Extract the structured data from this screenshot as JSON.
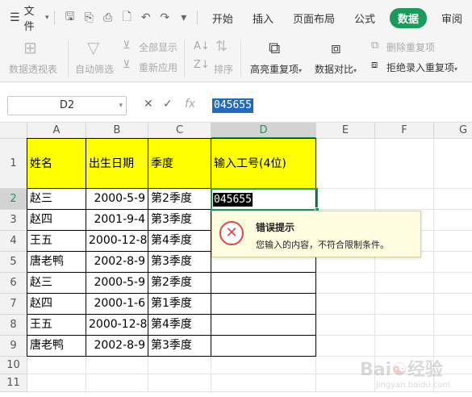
{
  "menu": {
    "file_label": "文件",
    "tabs": [
      {
        "label": "开始",
        "active": false
      },
      {
        "label": "插入",
        "active": false
      },
      {
        "label": "页面布局",
        "active": false
      },
      {
        "label": "公式",
        "active": false
      },
      {
        "label": "数据",
        "active": true
      },
      {
        "label": "审阅",
        "active": false
      }
    ]
  },
  "ribbon": {
    "pivot_label": "数据透视表",
    "autofilter_label": "自动筛选",
    "show_all_label": "全部显示",
    "reapply_label": "重新应用",
    "sort_label": "排序",
    "highlight_dup_label": "高亮重复项",
    "compare_label": "数据对比",
    "remove_dup_label": "删除重复项",
    "reject_dup_label": "拒绝录入重复项"
  },
  "formula_bar": {
    "name_box": "D2",
    "fx": "fx",
    "content": "045655"
  },
  "columns": [
    "A",
    "B",
    "C",
    "D",
    "E",
    "F",
    "G"
  ],
  "rows": [
    "1",
    "2",
    "3",
    "4",
    "5",
    "6",
    "7",
    "8",
    "9",
    "10",
    "11"
  ],
  "table": {
    "headers": [
      "姓名",
      "出生日期",
      "季度",
      "输入工号(4位)"
    ],
    "data": [
      [
        "赵三",
        "2000-5-9",
        "第2季度"
      ],
      [
        "赵四",
        "2001-9-4",
        "第3季度"
      ],
      [
        "王五",
        "2000-12-8",
        "第4季度"
      ],
      [
        "唐老鸭",
        "2002-8-9",
        "第3季度"
      ],
      [
        "赵三",
        "2000-5-9",
        "第2季度"
      ],
      [
        "赵四",
        "2000-1-6",
        "第1季度"
      ],
      [
        "王五",
        "2000-12-8",
        "第4季度"
      ],
      [
        "唐老鸭",
        "2002-8-9",
        "第3季度"
      ]
    ],
    "active_cell_value": "045655"
  },
  "error_tip": {
    "title": "错误提示",
    "message": "您输入的内容，不符合限制条件。"
  },
  "colors": {
    "accent": "#1a9a5b",
    "header_fill": "#ffff00",
    "error": "#e54545"
  }
}
